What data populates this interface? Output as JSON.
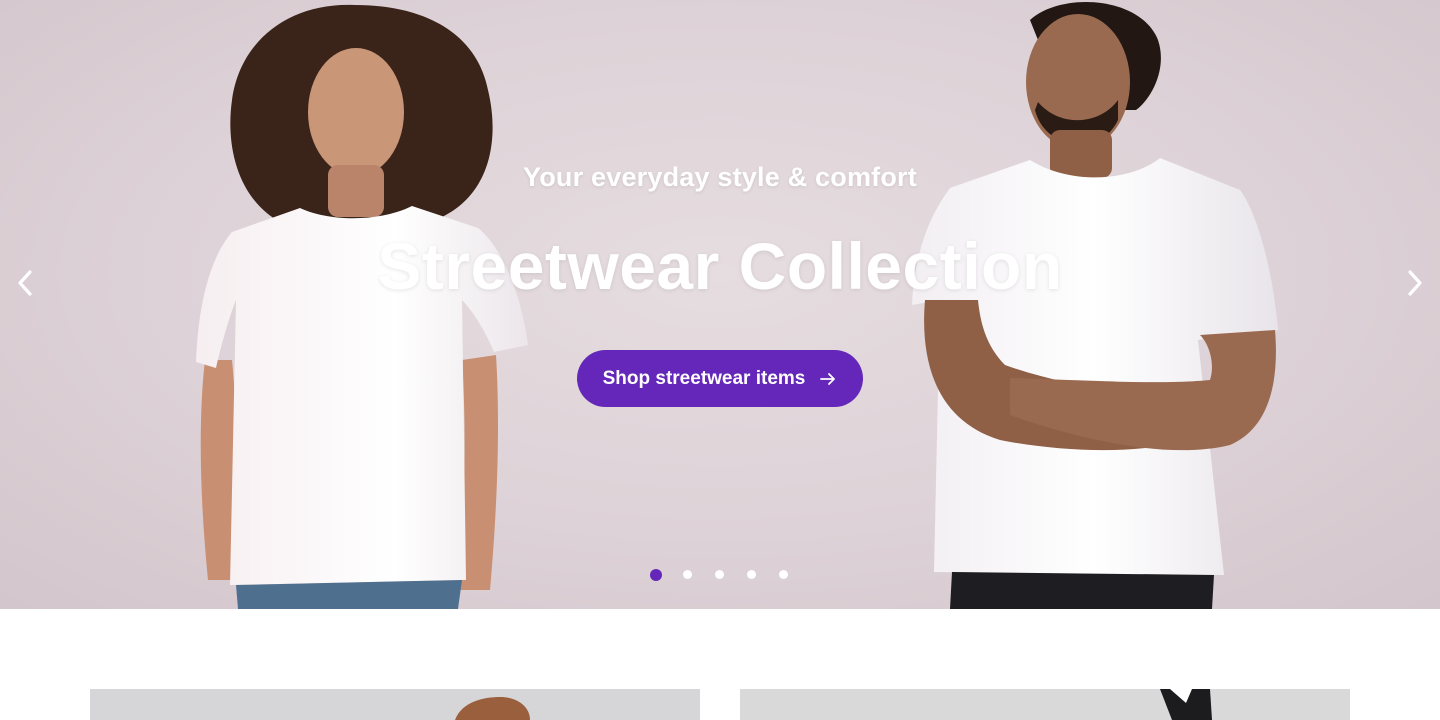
{
  "hero": {
    "subtitle": "Your everyday style & comfort",
    "title": "Streetwear Collection",
    "cta_label": "Shop streetwear items",
    "cta_icon": "arrow-right-icon",
    "prev_icon": "chevron-left-icon",
    "next_icon": "chevron-right-icon",
    "slides_total": 5,
    "active_slide": 1
  },
  "colors": {
    "accent": "#6427b9",
    "hero_bg": "#ddd2d7",
    "text_on_hero": "#ffffff"
  }
}
